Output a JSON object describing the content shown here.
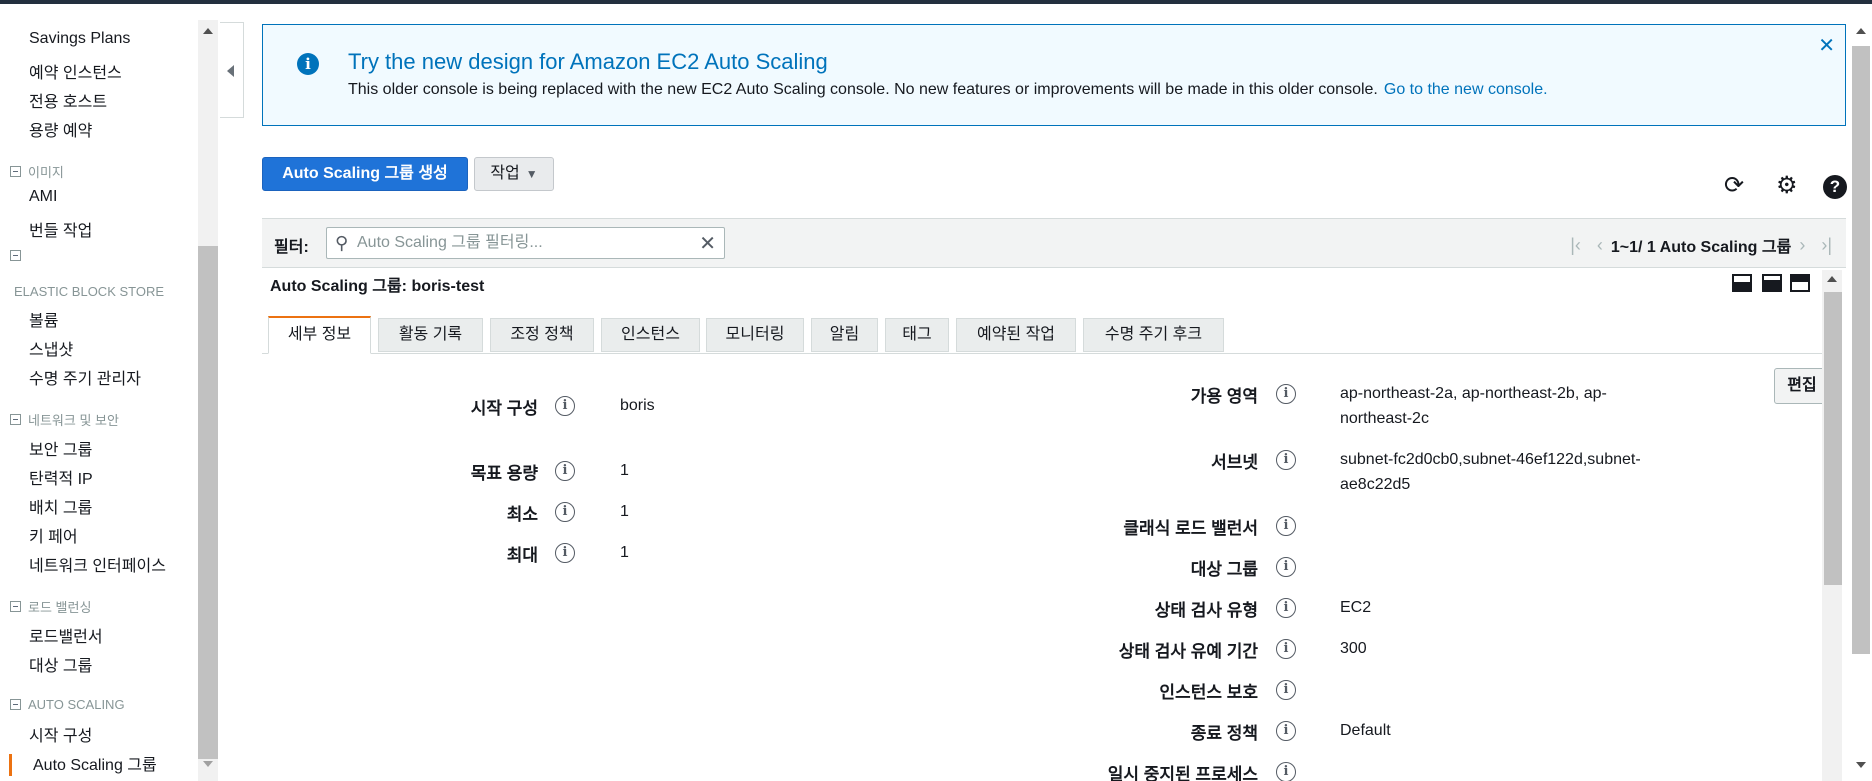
{
  "sidebar": {
    "items_top": [
      "Savings Plans",
      "예약 인스턴스",
      "전용 호스트",
      "용량 예약"
    ],
    "section_image": "이미지",
    "image_items": [
      "AMI",
      "번들 작업"
    ],
    "section_ebs": "ELASTIC BLOCK STORE",
    "ebs_items": [
      "볼륨",
      "스냅샷",
      "수명 주기 관리자"
    ],
    "section_network": "네트워크 및 보안",
    "network_items": [
      "보안 그룹",
      "탄력적 IP",
      "배치 그룹",
      "키 페어",
      "네트워크 인터페이스"
    ],
    "section_lb": "로드 밸런싱",
    "lb_items": [
      "로드밸런서",
      "대상 그룹"
    ],
    "section_as": "AUTO SCALING",
    "as_items": [
      "시작 구성",
      "Auto Scaling 그룹"
    ]
  },
  "banner": {
    "title": "Try the new design for Amazon EC2 Auto Scaling",
    "description": "This older console is being replaced with the new EC2 Auto Scaling console. No new features or improvements will be made in this older console.",
    "link": "Go to the new console.",
    "info_glyph": "i",
    "close_glyph": "✕"
  },
  "toolbar": {
    "create_label": "Auto Scaling 그룹 생성",
    "action_label": "작업",
    "refresh_glyph": "⟳",
    "settings_glyph": "⚙",
    "help_glyph": "?"
  },
  "filter": {
    "label": "필터:",
    "placeholder": "Auto Scaling 그룹 필터링...",
    "pager_text": "1~1/ 1 Auto Scaling 그룹"
  },
  "detail": {
    "title": "Auto Scaling 그룹: boris-test",
    "edit_label": "편집"
  },
  "tabs": [
    "세부 정보",
    "활동 기록",
    "조정 정책",
    "인스턴스",
    "모니터링",
    "알림",
    "태그",
    "예약된 작업",
    "수명 주기 후크"
  ],
  "left_fields": [
    {
      "key": "시작 구성",
      "value": "boris"
    },
    {
      "key": "목표 용량",
      "value": "1"
    },
    {
      "key": "최소",
      "value": "1"
    },
    {
      "key": "최대",
      "value": "1"
    }
  ],
  "right_fields": [
    {
      "key": "가용 영역",
      "value_line1": "ap-northeast-2a, ap-northeast-2b, ap-",
      "value_line2": "northeast-2c"
    },
    {
      "key": "서브넷",
      "value_line1": "subnet-fc2d0cb0,subnet-46ef122d,subnet-",
      "value_line2": "ae8c22d5"
    },
    {
      "key": "클래식 로드 밸런서",
      "value_line1": ""
    },
    {
      "key": "대상 그룹",
      "value_line1": ""
    },
    {
      "key": "상태 검사 유형",
      "value_line1": "EC2"
    },
    {
      "key": "상태 검사 유예 기간",
      "value_line1": "300"
    },
    {
      "key": "인스턴스 보호",
      "value_line1": ""
    },
    {
      "key": "종료 정책",
      "value_line1": "Default"
    },
    {
      "key": "일시 중지된 프로세스",
      "value_line1": ""
    }
  ],
  "info_glyph": "i"
}
